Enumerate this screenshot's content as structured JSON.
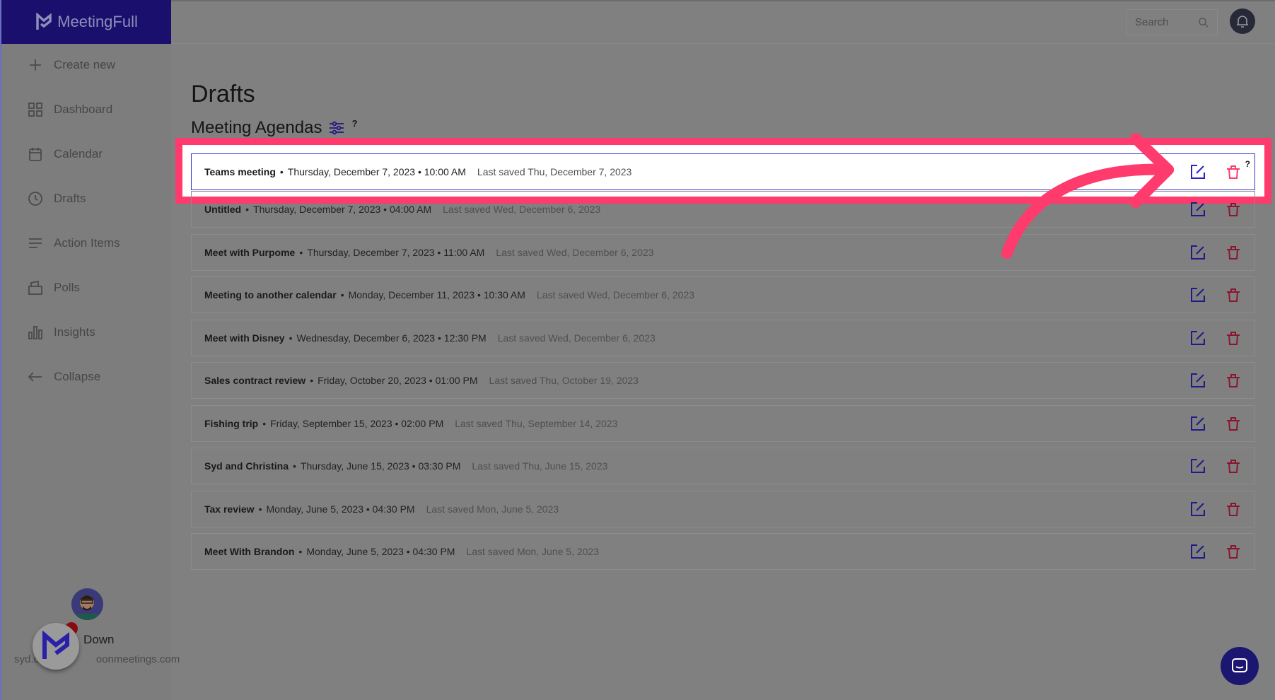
{
  "app": {
    "name": "MeetingFull"
  },
  "sidebar": {
    "items": [
      {
        "label": "Create new",
        "icon": "plus-icon"
      },
      {
        "label": "Dashboard",
        "icon": "grid-icon"
      },
      {
        "label": "Calendar",
        "icon": "calendar-icon"
      },
      {
        "label": "Drafts",
        "icon": "clock-icon"
      },
      {
        "label": "Action Items",
        "icon": "list-icon"
      },
      {
        "label": "Polls",
        "icon": "ballot-icon"
      },
      {
        "label": "Insights",
        "icon": "bar-chart-icon"
      },
      {
        "label": "Collapse",
        "icon": "arrow-left-icon"
      }
    ],
    "user": {
      "name_visible": "Down",
      "email_start": "syd.d",
      "email_end": "oonmeetings.com"
    }
  },
  "header": {
    "search_placeholder": "Search"
  },
  "main": {
    "title": "Drafts",
    "subtitle": "Meeting Agendas",
    "help": "?"
  },
  "drafts": [
    {
      "name": "Teams meeting",
      "when": "Thursday, December 7, 2023 • 10:00 AM",
      "saved": "Last saved Thu, December 7, 2023"
    },
    {
      "name": "Untitled",
      "when": "Thursday, December 7, 2023 • 04:00 AM",
      "saved": "Last saved Wed, December 6, 2023"
    },
    {
      "name": "Meet with Purpome",
      "when": "Thursday, December 7, 2023 • 11:00 AM",
      "saved": "Last saved Wed, December 6, 2023"
    },
    {
      "name": "Meeting to another calendar",
      "when": "Monday, December 11, 2023 • 10:30 AM",
      "saved": "Last saved Wed, December 6, 2023"
    },
    {
      "name": "Meet with Disney",
      "when": "Wednesday, December 6, 2023 • 12:30 PM",
      "saved": "Last saved Wed, December 6, 2023"
    },
    {
      "name": "Sales contract review",
      "when": "Friday, October 20, 2023 • 01:00 PM",
      "saved": "Last saved Thu, October 19, 2023"
    },
    {
      "name": "Fishing trip",
      "when": "Friday, September 15, 2023 • 02:00 PM",
      "saved": "Last saved Thu, September 14, 2023"
    },
    {
      "name": "Syd and Christina",
      "when": "Thursday, June 15, 2023 • 03:30 PM",
      "saved": "Last saved Thu, June 15, 2023"
    },
    {
      "name": "Tax review",
      "when": "Monday, June 5, 2023 • 04:30 PM",
      "saved": "Last saved Mon, June 5, 2023"
    },
    {
      "name": "Meet With Brandon",
      "when": "Monday, June 5, 2023 • 04:30 PM",
      "saved": "Last saved Mon, June 5, 2023"
    }
  ],
  "colors": {
    "brand": "#1a0f6c",
    "highlight": "#ff3a6c",
    "edit": "#2a22c8",
    "delete": "#ff3a6c"
  }
}
